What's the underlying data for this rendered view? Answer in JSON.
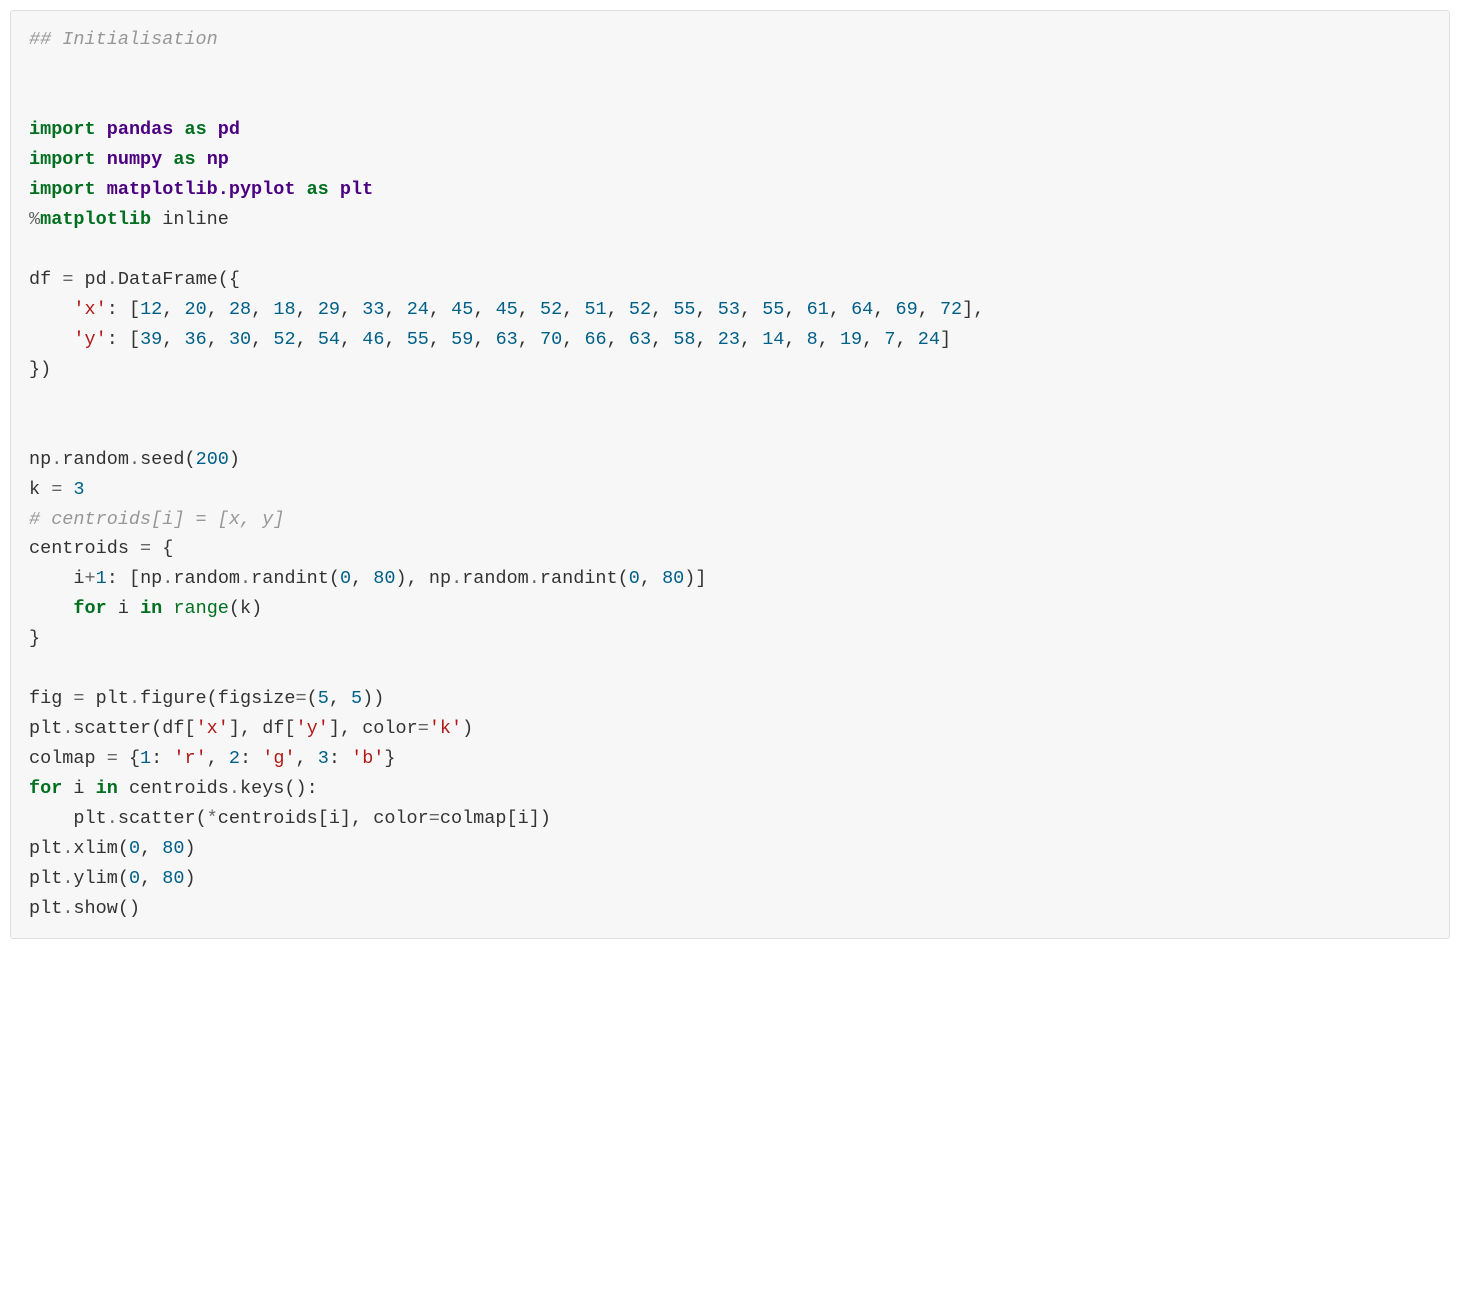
{
  "code": {
    "comment_header": "## Initialisation",
    "import_kw": "import",
    "as_kw": "as",
    "pandas": "pandas",
    "pd": "pd",
    "numpy": "numpy",
    "np": "np",
    "mpl": "matplotlib.pyplot",
    "plt": "plt",
    "magic_pct": "%",
    "magic_name": "matplotlib",
    "magic_arg": " inline",
    "df_name": "df",
    "eq": " = ",
    "pd_call": "pd",
    "dot": ".",
    "DataFrame": "DataFrame",
    "openp": "(",
    "closep": ")",
    "openb": "{",
    "closeb": "}",
    "opensq": "[",
    "closesq": "]",
    "comma": ", ",
    "colon": ": ",
    "x_key": "'x'",
    "y_key": "'y'",
    "x_vals": [
      "12",
      "20",
      "28",
      "18",
      "29",
      "33",
      "24",
      "45",
      "45",
      "52",
      "51",
      "52",
      "55",
      "53",
      "55",
      "61",
      "64",
      "69",
      "72"
    ],
    "y_vals": [
      "39",
      "36",
      "30",
      "52",
      "54",
      "46",
      "55",
      "59",
      "63",
      "70",
      "66",
      "63",
      "58",
      "23",
      "14",
      "8",
      "19",
      "7",
      "24"
    ],
    "np_name": "np",
    "random": "random",
    "seed": "seed",
    "seed_val": "200",
    "k_name": "k",
    "k_val": "3",
    "centroids_comment": "# centroids[i] = [x, y]",
    "centroids": "centroids",
    "i_name": "i",
    "plus": "+",
    "one": "1",
    "randint": "randint",
    "zero": "0",
    "eighty": "80",
    "for_kw": "for",
    "in_kw": "in",
    "range": "range",
    "fig": "fig",
    "figure": "figure",
    "figsize": "figsize",
    "figsize_eq": "=",
    "five": "5",
    "scatter": "scatter",
    "color_kw": "color",
    "k_str": "'k'",
    "colmap": "colmap",
    "one_num": "1",
    "two_num": "2",
    "three_num": "3",
    "r_str": "'r'",
    "g_str": "'g'",
    "b_str": "'b'",
    "keys": "keys",
    "star": "*",
    "xlim": "xlim",
    "ylim": "ylim",
    "show": "show",
    "y_str": "'y'",
    "x_str": "'x'"
  }
}
